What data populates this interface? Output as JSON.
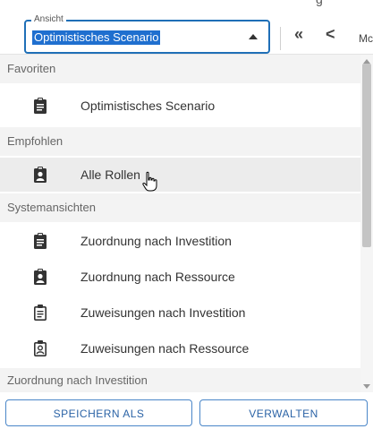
{
  "header": {
    "top_edge_text": "g",
    "view_legend": "Ansicht",
    "view_value": "Optimistisches Scenario",
    "nav_first": "«",
    "nav_prev": "<",
    "clipped_text": "Mc"
  },
  "dropdown": {
    "groups": [
      {
        "title": "Favoriten",
        "items": [
          {
            "label": "Optimistisches Scenario",
            "icon": "clipboard-list-icon"
          }
        ]
      },
      {
        "title": "Empfohlen",
        "items": [
          {
            "label": "Alle Rollen",
            "icon": "clipboard-user-icon"
          }
        ]
      },
      {
        "title": "Systemansichten",
        "items": [
          {
            "label": "Zuordnung nach Investition",
            "icon": "clipboard-list-icon"
          },
          {
            "label": "Zuordnung nach Ressource",
            "icon": "clipboard-user-icon"
          },
          {
            "label": "Zuweisungen nach Investition",
            "icon": "clipboard-list-outline-icon"
          },
          {
            "label": "Zuweisungen nach Ressource",
            "icon": "clipboard-user-outline-icon"
          }
        ]
      }
    ],
    "bottom_partial": "Zuordnung nach Investition"
  },
  "footer": {
    "save_as": "SPEICHERN ALS",
    "manage": "VERWALTEN"
  },
  "colors": {
    "accent": "#1f6fb7",
    "selection": "#1f6fcf",
    "button_text": "#2b63a6"
  }
}
